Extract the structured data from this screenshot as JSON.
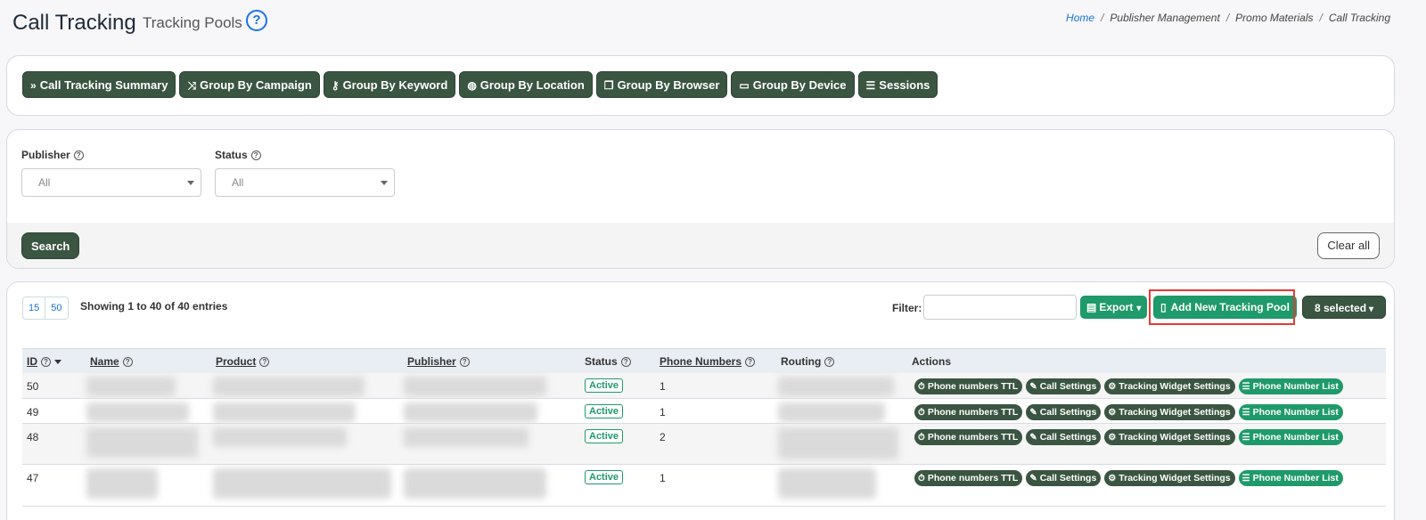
{
  "header": {
    "title": "Call Tracking",
    "subtitle": "Tracking Pools",
    "help_glyph": "?",
    "breadcrumb": [
      "Home",
      "Publisher Management",
      "Promo Materials",
      "Call Tracking"
    ]
  },
  "tabs": [
    {
      "label": "Call Tracking Summary",
      "icon": "double-chevron-right-icon",
      "glyph": "»"
    },
    {
      "label": "Group By Campaign",
      "icon": "shuffle-icon",
      "glyph": "⤨"
    },
    {
      "label": "Group By Keyword",
      "icon": "key-icon",
      "glyph": "⚷"
    },
    {
      "label": "Group By Location",
      "icon": "globe-icon",
      "glyph": "◍"
    },
    {
      "label": "Group By Browser",
      "icon": "windows-icon",
      "glyph": "❐"
    },
    {
      "label": "Group By Device",
      "icon": "laptop-icon",
      "glyph": "▭"
    },
    {
      "label": "Sessions",
      "icon": "list-icon",
      "glyph": "☰"
    }
  ],
  "filters": {
    "publisher_label": "Publisher",
    "publisher_value": "All",
    "status_label": "Status",
    "status_value": "All",
    "help_glyph": "?",
    "search_label": "Search",
    "clear_label": "Clear all"
  },
  "table_controls": {
    "page_sizes": [
      "15",
      "50"
    ],
    "showing": "Showing 1 to 40 of 40 entries",
    "filter_label": "Filter:",
    "export_label": "Export",
    "export_glyph": "▤",
    "caret_glyph": "▾",
    "add_label": "Add New Tracking Pool",
    "add_glyph": "▯",
    "selected_label": "8 selected"
  },
  "columns": {
    "id": "ID",
    "name": "Name",
    "product": "Product",
    "publisher": "Publisher",
    "status": "Status",
    "phone_numbers": "Phone Numbers",
    "routing": "Routing",
    "actions": "Actions",
    "help_glyph": "?"
  },
  "rows": [
    {
      "id": "50",
      "status": "Active",
      "phone_numbers": "1"
    },
    {
      "id": "49",
      "status": "Active",
      "phone_numbers": "1"
    },
    {
      "id": "48",
      "status": "Active",
      "phone_numbers": "2"
    },
    {
      "id": "47",
      "status": "Active",
      "phone_numbers": "1"
    }
  ],
  "row_actions": [
    {
      "label": "Phone numbers TTL",
      "icon": "stopwatch-icon",
      "glyph": "⏱",
      "style": "dark"
    },
    {
      "label": "Call Settings",
      "icon": "pencil-icon",
      "glyph": "✎",
      "style": "dark"
    },
    {
      "label": "Tracking Widget Settings",
      "icon": "gears-icon",
      "glyph": "⚙",
      "style": "dark"
    },
    {
      "label": "Phone Number List",
      "icon": "list-icon",
      "glyph": "☰",
      "style": "green"
    }
  ],
  "colors": {
    "dark_green": "#3a5541",
    "accent_green": "#1f9a6a",
    "link_blue": "#1a73e8",
    "highlight_red": "#e53935"
  }
}
